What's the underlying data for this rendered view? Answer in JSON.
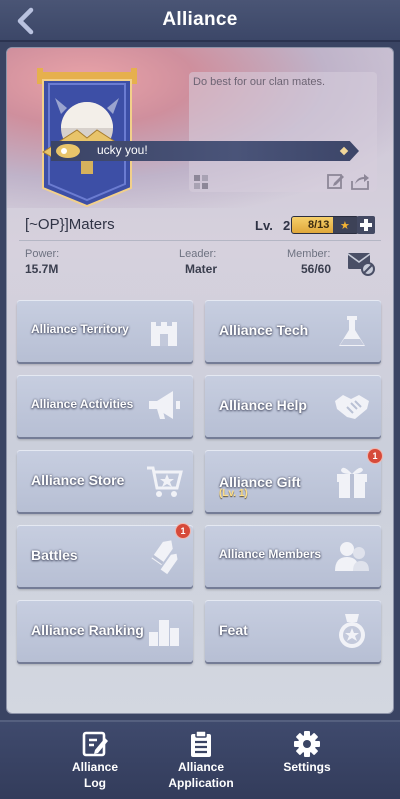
{
  "header": {
    "title": "Alliance",
    "back_icon": "chevron-left-icon"
  },
  "banner": {
    "motto": "Do best for our clan mates.",
    "lucky_text": "ucky you!",
    "flag_icon": "alliance-flag-emblem"
  },
  "info": {
    "name": "[~OP}]Maters",
    "level_label": "Lv.",
    "level_value": "2",
    "xp_text": "8/13",
    "xp_fraction": 0.615,
    "power_label": "Power:",
    "power_value": "15.7M",
    "leader_label": "Leader:",
    "leader_value": "Mater",
    "member_label": "Member:",
    "member_value": "56/60"
  },
  "buttons": [
    {
      "label": "Alliance Territory",
      "icon": "castle-icon",
      "badge": ""
    },
    {
      "label": "Alliance Tech",
      "icon": "flask-icon",
      "badge": ""
    },
    {
      "label": "Alliance Activities",
      "icon": "megaphone-icon",
      "badge": ""
    },
    {
      "label": "Alliance Help",
      "icon": "handshake-icon",
      "badge": ""
    },
    {
      "label": "Alliance Store",
      "icon": "cart-icon",
      "badge": ""
    },
    {
      "label": "Alliance Gift",
      "sublabel": "(Lv. 1)",
      "icon": "gift-icon",
      "badge": "1"
    },
    {
      "label": "Battles",
      "icon": "bullets-icon",
      "badge": "1"
    },
    {
      "label": "Alliance Members",
      "icon": "members-icon",
      "badge": ""
    },
    {
      "label": "Alliance Ranking",
      "icon": "bar-chart-icon",
      "badge": ""
    },
    {
      "label": "Feat",
      "icon": "medal-icon",
      "badge": ""
    }
  ],
  "bottom_nav": [
    {
      "label_1": "Alliance",
      "label_2": "Log",
      "icon": "edit-log-icon"
    },
    {
      "label_1": "Alliance",
      "label_2": "Application",
      "icon": "clipboard-icon"
    },
    {
      "label_1": "Settings",
      "label_2": "",
      "icon": "gear-icon"
    }
  ],
  "colors": {
    "header_bg": "#3c4768",
    "button_bg": "#bfc6da",
    "badge_red": "#d64a3a",
    "xp_gold": "#f0c054"
  }
}
